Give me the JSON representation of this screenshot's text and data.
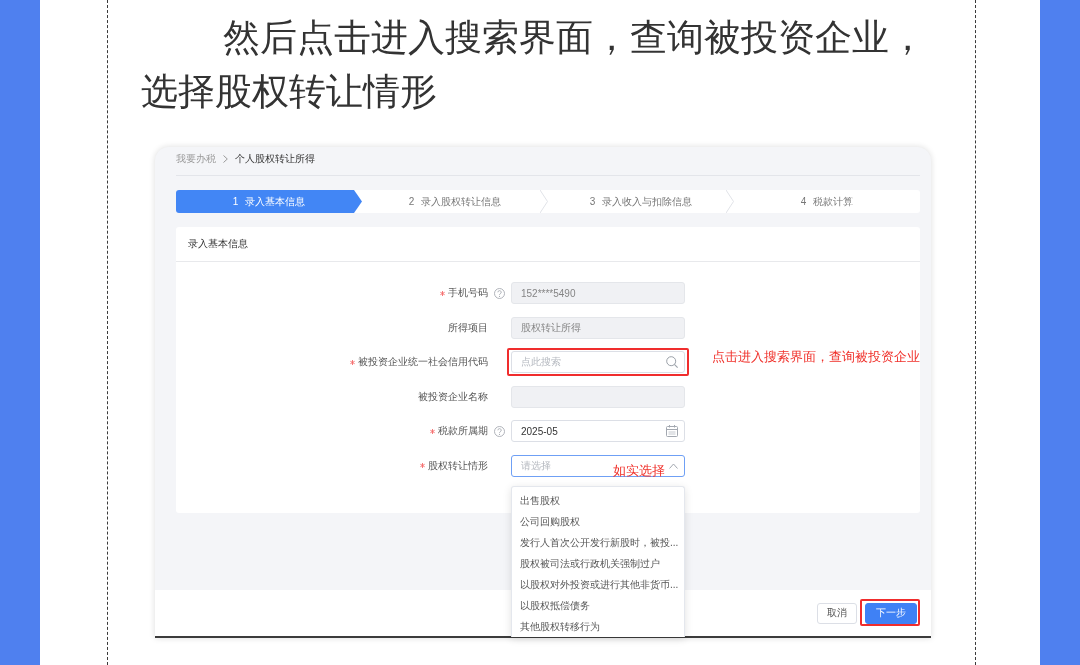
{
  "article": {
    "heading": "然后点击进入搜索界面，查询被投资企业，选择股权转让情形"
  },
  "screenshot": {
    "breadcrumb": [
      {
        "label": "我要办税",
        "current": false
      },
      {
        "label": "个人股权转让所得",
        "current": true
      }
    ],
    "steps": [
      {
        "number": "1",
        "label": "录入基本信息",
        "selected": true
      },
      {
        "number": "2",
        "label": "录入股权转让信息",
        "selected": false
      },
      {
        "number": "3",
        "label": "录入收入与扣除信息",
        "selected": false
      },
      {
        "number": "4",
        "label": "税款计算",
        "selected": false
      }
    ],
    "section_title": "录入基本信息",
    "fields": [
      {
        "kind": "text",
        "label": "手机号码",
        "required": true,
        "help": true,
        "disabled": true,
        "highlighted": false,
        "value": "152****5490"
      },
      {
        "kind": "text",
        "label": "所得项目",
        "required": false,
        "help": false,
        "disabled": true,
        "highlighted": false,
        "value": "股权转让所得"
      },
      {
        "kind": "search",
        "label": "被投资企业统一社会信用代码",
        "required": true,
        "help": false,
        "disabled": false,
        "highlighted": true,
        "placeholder": "点此搜索",
        "annotation": "点击进入搜索界面，查询被投资企业"
      },
      {
        "kind": "text",
        "label": "被投资企业名称",
        "required": false,
        "help": false,
        "disabled": true,
        "highlighted": false
      },
      {
        "kind": "date",
        "label": "税款所属期",
        "required": true,
        "help": true,
        "disabled": false,
        "highlighted": false,
        "value": "2025-05"
      },
      {
        "kind": "select",
        "label": "股权转让情形",
        "required": true,
        "help": false,
        "disabled": false,
        "highlighted": false,
        "placeholder": "请选择",
        "expanded": true,
        "annotation": "如实选择",
        "options": [
          "出售股权",
          "公司回购股权",
          "发行人首次公开发行新股时，被投...",
          "股权被司法或行政机关强制过户",
          "以股权对外投资或进行其他非货币...",
          "以股权抵偿债务",
          "其他股权转移行为"
        ]
      }
    ],
    "buttons": [
      {
        "kind": "secondary",
        "label": "取消",
        "highlighted": false
      },
      {
        "kind": "primary",
        "label": "下一步",
        "highlighted": true
      }
    ]
  }
}
